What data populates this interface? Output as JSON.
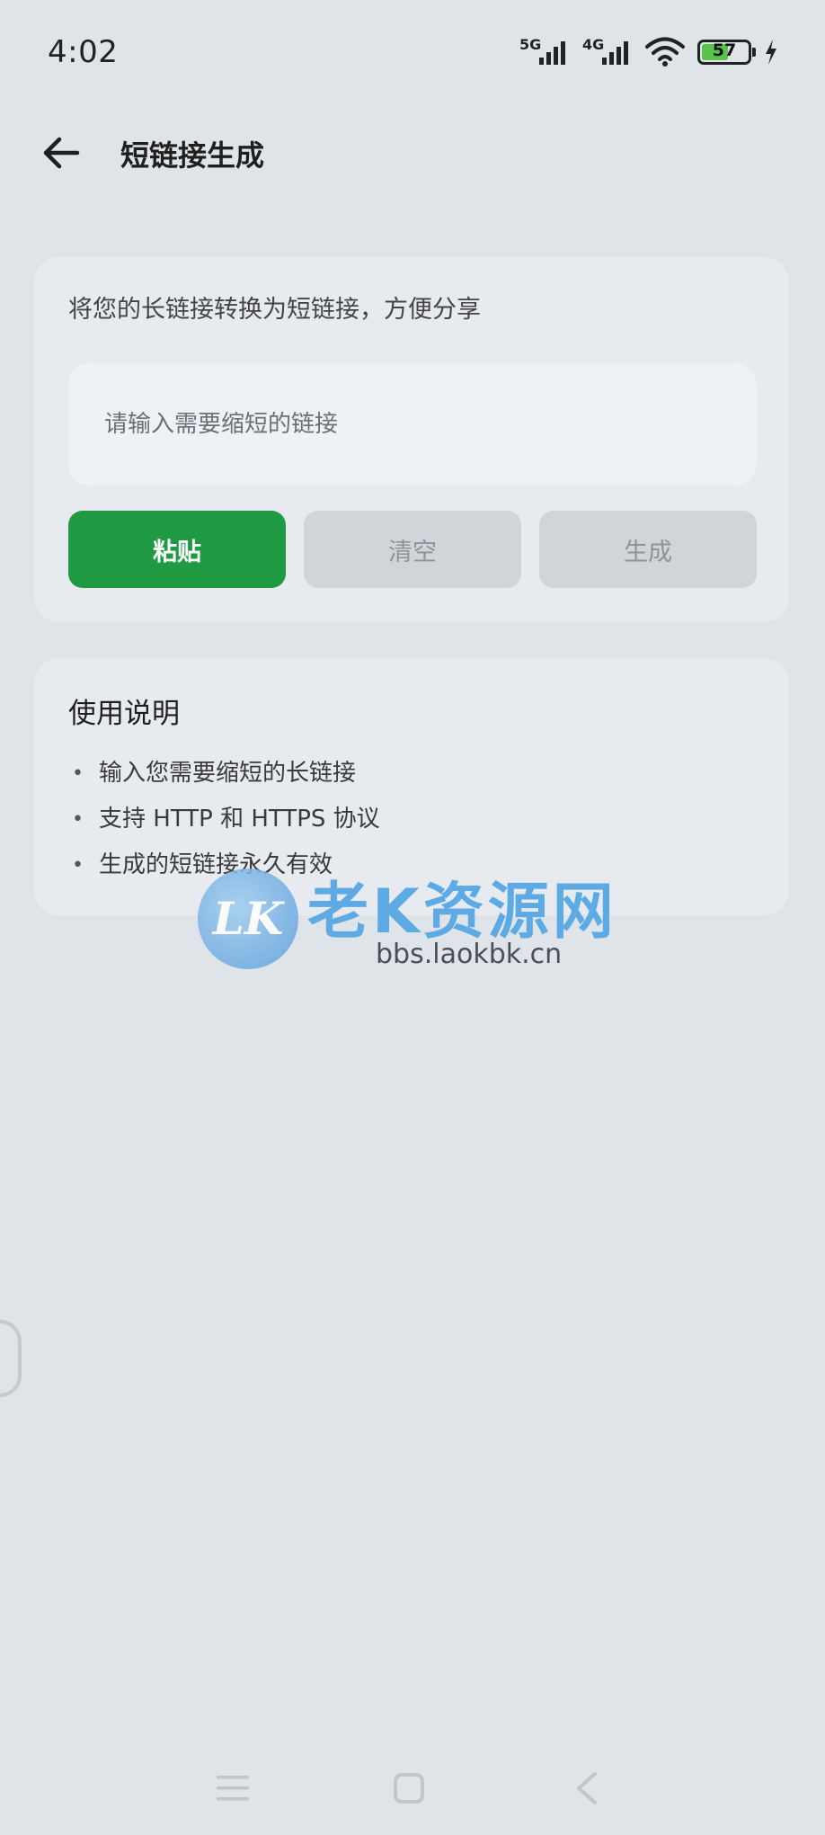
{
  "status_bar": {
    "time": "4:02",
    "network_1": "5G",
    "network_2": "4G",
    "battery_percent": 57,
    "battery_label": "57",
    "charging": true
  },
  "header": {
    "title": "短链接生成"
  },
  "converter": {
    "description": "将您的长链接转换为短链接，方便分享",
    "input_placeholder": "请输入需要缩短的链接",
    "input_value": "",
    "paste_label": "粘贴",
    "clear_label": "清空",
    "generate_label": "生成"
  },
  "instructions": {
    "title": "使用说明",
    "items": [
      "输入您需要缩短的长链接",
      "支持 HTTP 和 HTTPS 协议",
      "生成的短链接永久有效"
    ]
  },
  "watermark": {
    "badge": "LK",
    "title": "老K资源网",
    "url": "bbs.laokbk.cn"
  },
  "colors": {
    "background": "#dfe4e8",
    "card": "#e7ebef",
    "primary": "#1f9a42",
    "disabled": "#d1d5d9",
    "watermark": "#4fa4e4"
  },
  "icons": {
    "back": "arrow-left-icon",
    "signal": "signal-bars-icon",
    "wifi": "wifi-icon",
    "battery": "battery-icon",
    "charging": "lightning-icon",
    "nav_menu": "menu-icon",
    "nav_home": "square-home-icon",
    "nav_back": "chevron-left-icon"
  }
}
